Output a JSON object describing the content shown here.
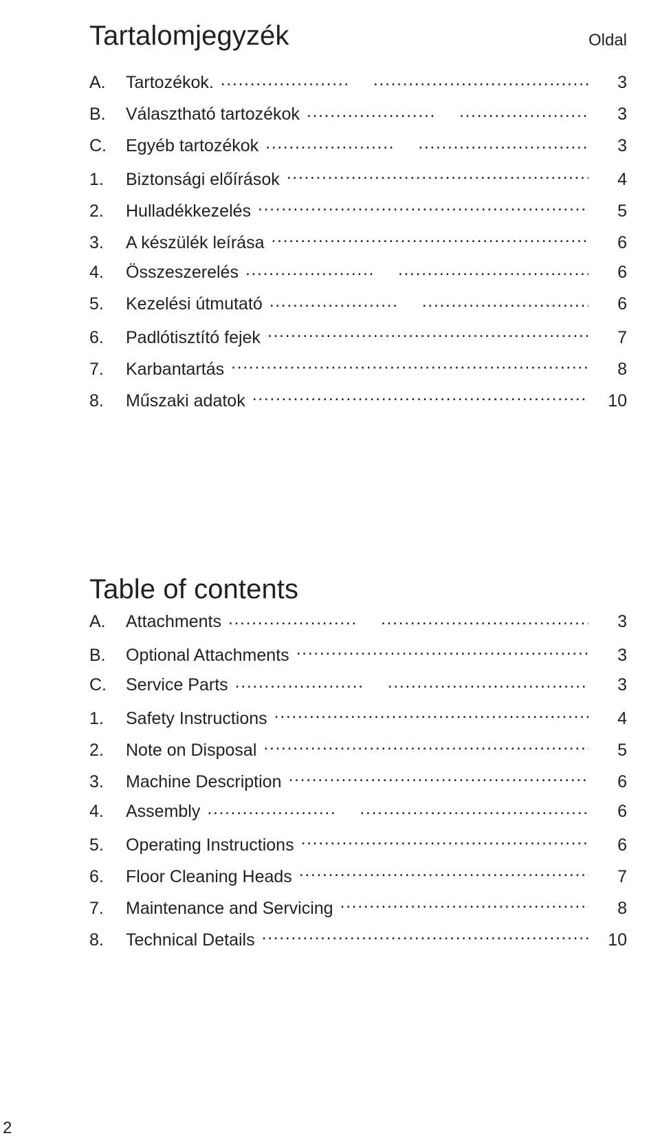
{
  "document": {
    "folio": "2",
    "page_column_label": "Oldal"
  },
  "sections": [
    {
      "heading": "Tartalomjegyzék",
      "language": "hu",
      "entries": [
        {
          "marker": "A.",
          "title": "Tartozékok.",
          "page": "3",
          "leader": "split"
        },
        {
          "marker": "B.",
          "title": "Választható tartozékok",
          "page": "3",
          "leader": "split"
        },
        {
          "marker": "C.",
          "title": "Egyéb tartozékok",
          "page": "3",
          "leader": "split"
        },
        {
          "marker": "1.",
          "title": "Biztonsági előírások",
          "page": "4",
          "leader": "single"
        },
        {
          "marker": "2.",
          "title": "Hulladékkezelés",
          "page": "5",
          "leader": "single"
        },
        {
          "marker": "3.",
          "title": "A készülék leírása",
          "page": "6",
          "leader": "single"
        },
        {
          "marker": "4.",
          "title": "Összeszerelés",
          "page": "6",
          "leader": "split"
        },
        {
          "marker": "5.",
          "title": "Kezelési útmutató",
          "page": "6",
          "leader": "split"
        },
        {
          "marker": "6.",
          "title": "Padlótisztító fejek",
          "page": "7",
          "leader": "single"
        },
        {
          "marker": "7.",
          "title": "Karbantartás",
          "page": "8",
          "leader": "single"
        },
        {
          "marker": "8.",
          "title": "Műszaki adatok",
          "page": "10",
          "leader": "single"
        }
      ]
    },
    {
      "heading": "Table of contents",
      "language": "en",
      "entries": [
        {
          "marker": "A.",
          "title": "Attachments",
          "page": "3",
          "leader": "split"
        },
        {
          "marker": "B.",
          "title": "Optional Attachments",
          "page": "3",
          "leader": "single"
        },
        {
          "marker": "C.",
          "title": "Service Parts",
          "page": "3",
          "leader": "split"
        },
        {
          "marker": "1.",
          "title": "Safety Instructions",
          "page": "4",
          "leader": "single"
        },
        {
          "marker": "2.",
          "title": "Note on Disposal",
          "page": "5",
          "leader": "single"
        },
        {
          "marker": "3.",
          "title": "Machine Description",
          "page": "6",
          "leader": "single"
        },
        {
          "marker": "4.",
          "title": "Assembly",
          "page": "6",
          "leader": "split"
        },
        {
          "marker": "5.",
          "title": "Operating Instructions",
          "page": "6",
          "leader": "single"
        },
        {
          "marker": "6.",
          "title": "Floor Cleaning Heads",
          "page": "7",
          "leader": "single"
        },
        {
          "marker": "7.",
          "title": "Maintenance and Servicing",
          "page": "8",
          "leader": "single"
        },
        {
          "marker": "8.",
          "title": "Technical Details",
          "page": "10",
          "leader": "single"
        }
      ]
    }
  ],
  "colors": {
    "text": "#231f20",
    "background": "#ffffff"
  }
}
